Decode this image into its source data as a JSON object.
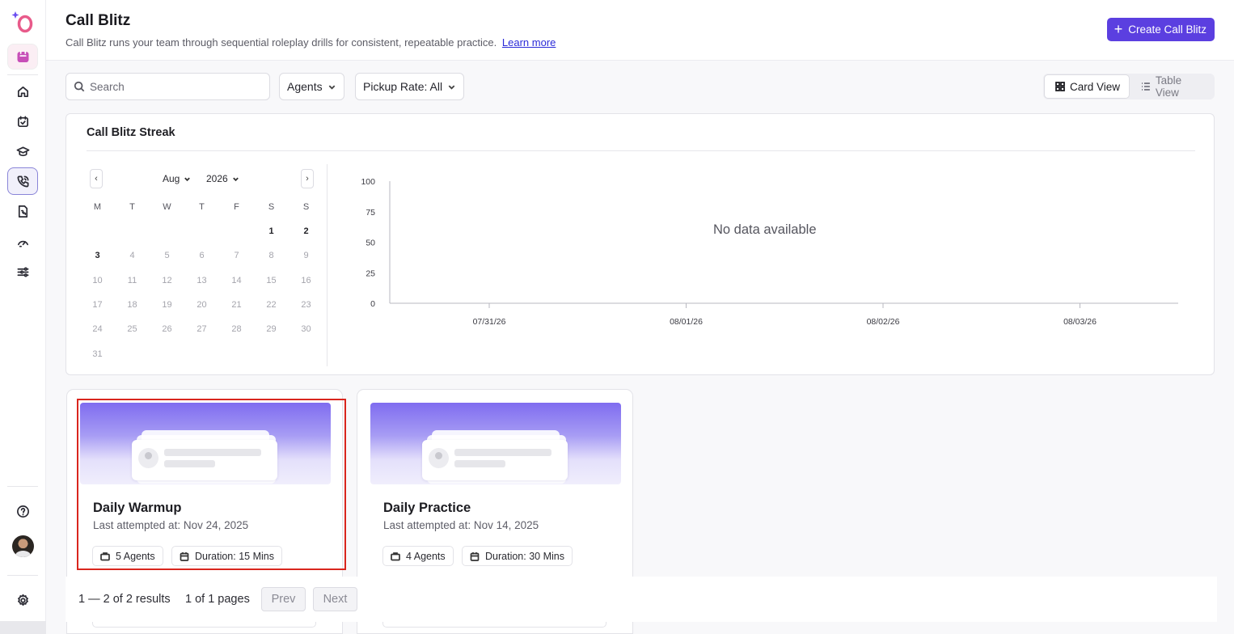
{
  "header": {
    "title": "Call Blitz",
    "subtitle": "Call Blitz runs your team through sequential roleplay drills for consistent, repeatable practice.",
    "learn_more": "Learn more",
    "create_button": "Create Call Blitz"
  },
  "filters": {
    "search_placeholder": "Search",
    "agents_label": "Agents",
    "pickup_label": "Pickup Rate: All",
    "card_view": "Card View",
    "table_view": "Table View"
  },
  "streak": {
    "title": "Call Blitz Streak",
    "month": "Aug",
    "year": "2026",
    "prev": "‹",
    "next": "›",
    "weekdays": [
      "M",
      "T",
      "W",
      "T",
      "F",
      "S",
      "S"
    ],
    "days": [
      "1",
      "2",
      "3",
      "4",
      "5",
      "6",
      "7",
      "8",
      "9",
      "10",
      "11",
      "12",
      "13",
      "14",
      "15",
      "16",
      "17",
      "18",
      "19",
      "20",
      "21",
      "22",
      "23",
      "24",
      "25",
      "26",
      "27",
      "28",
      "29",
      "30",
      "31"
    ]
  },
  "chart_data": {
    "type": "line",
    "x": [
      "07/31/26",
      "08/01/26",
      "08/02/26",
      "08/03/26"
    ],
    "series": [],
    "ylim": [
      0,
      100
    ],
    "yticks": [
      "100",
      "75",
      "50",
      "25",
      "0"
    ],
    "annotation": "No data available"
  },
  "cards": [
    {
      "title": "Daily Warmup",
      "subtitle": "Last attempted at: Nov 24, 2025",
      "agents": "5 Agents",
      "duration": "Duration: 15 Mins"
    },
    {
      "title": "Daily Practice",
      "subtitle": "Last attempted at: Nov 14, 2025",
      "agents": "4 Agents",
      "duration": "Duration: 30 Mins"
    }
  ],
  "pagination": {
    "results": "1 — 2 of 2 results",
    "pages": "1 of 1 pages",
    "prev": "Prev",
    "next": "Next"
  },
  "colors": {
    "accent": "#5b3fe0",
    "highlight": "#d9261e"
  }
}
